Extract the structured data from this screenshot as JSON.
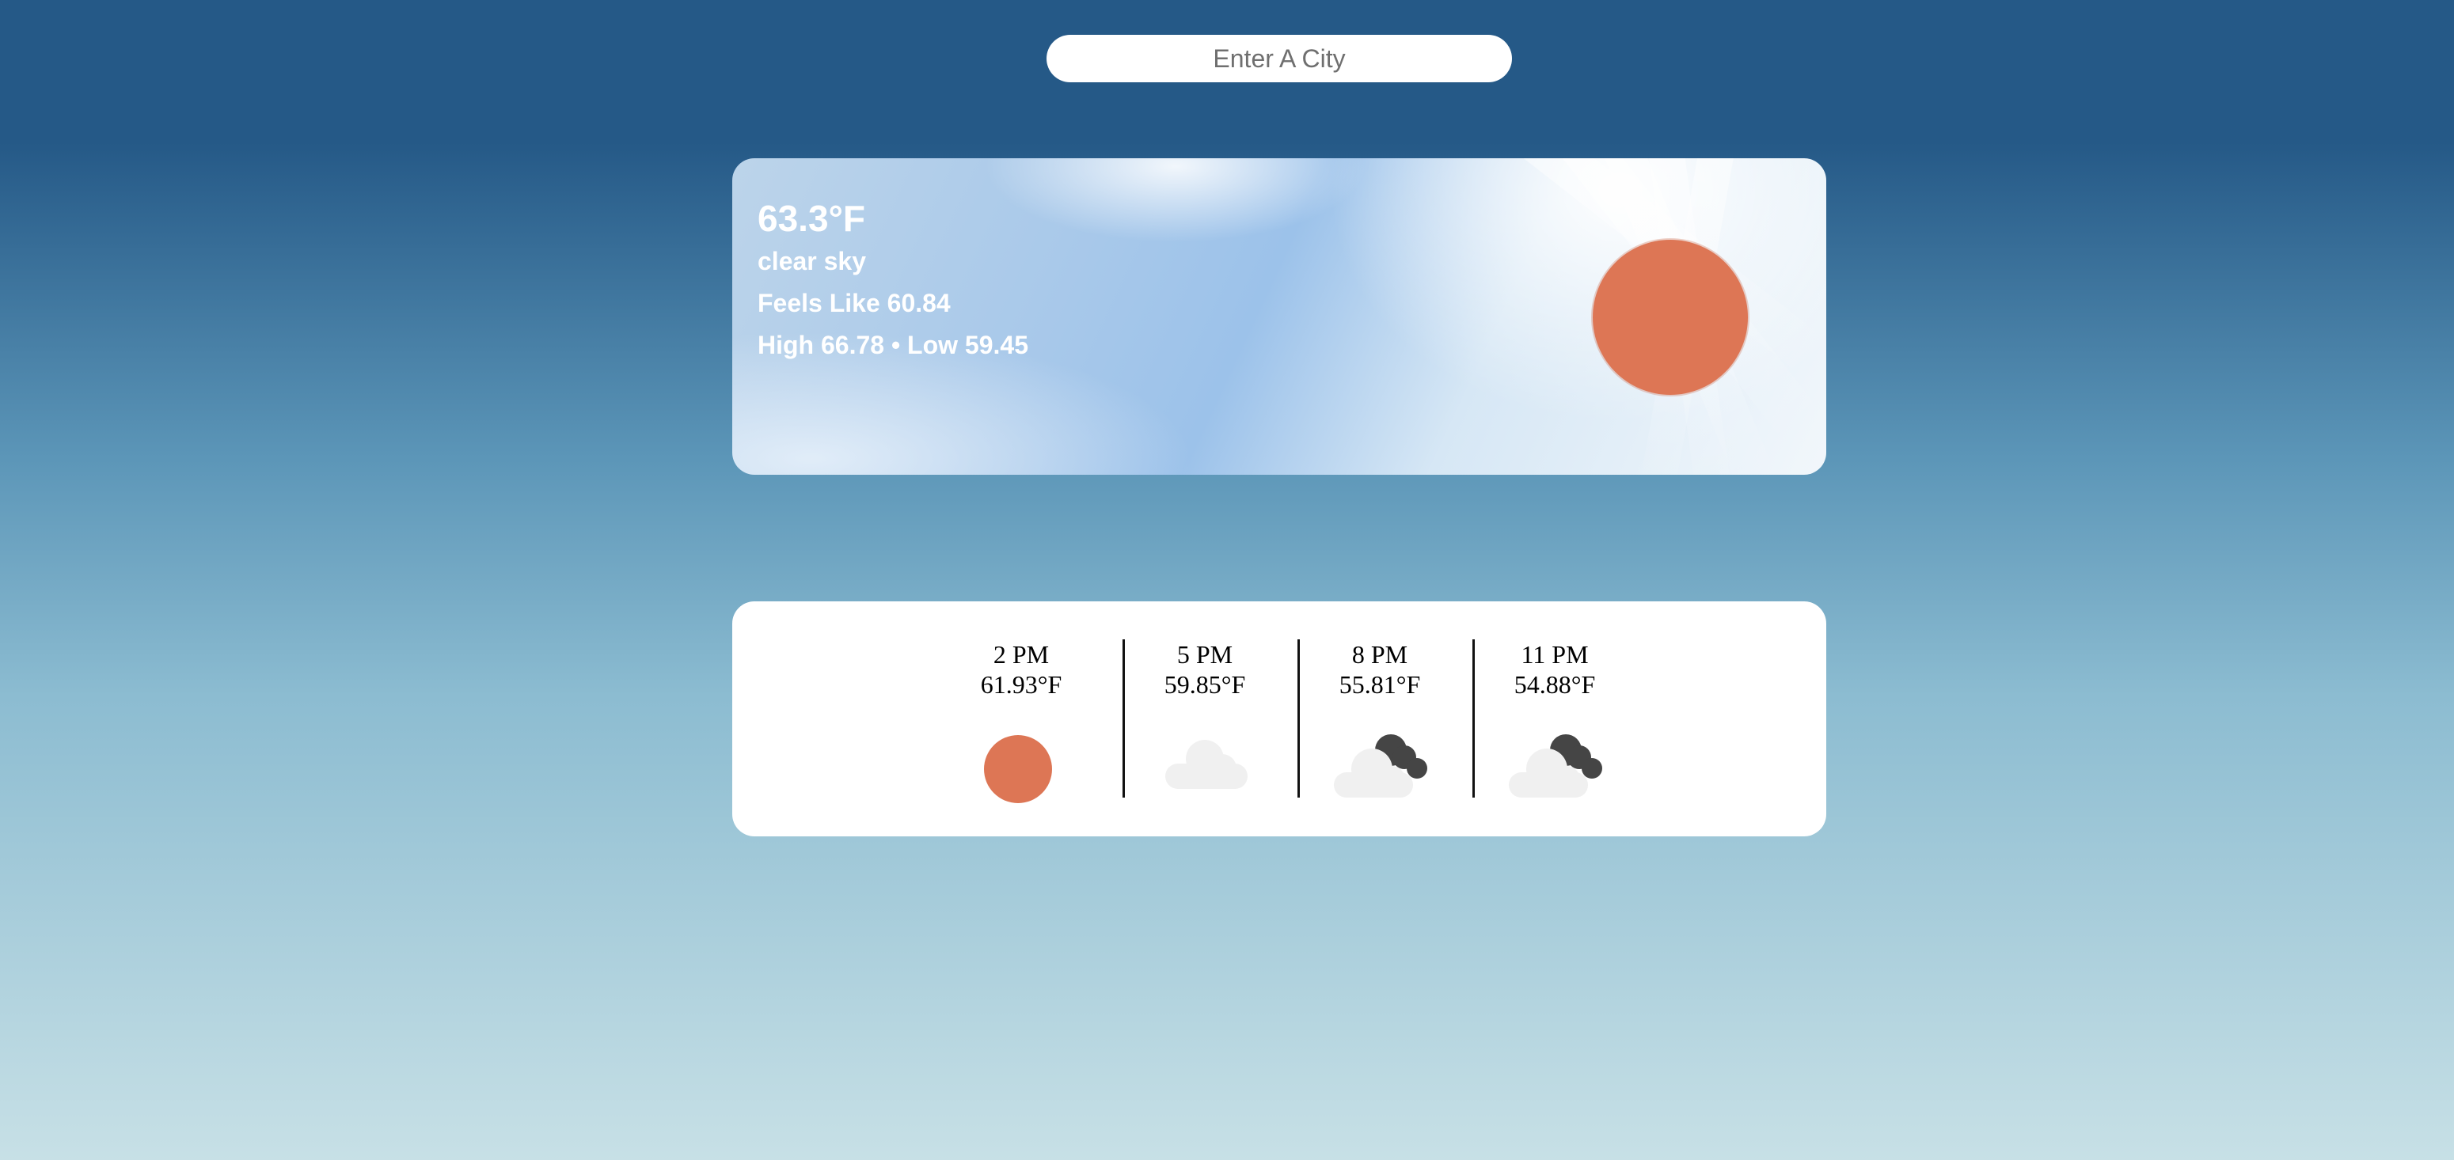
{
  "search": {
    "placeholder": "Enter A City",
    "value": ""
  },
  "current": {
    "temperature": "63.3°F",
    "description": "clear sky",
    "feels_like": "Feels Like 60.84",
    "high_low": "High 66.78 • Low 59.45",
    "icon": "sun-icon",
    "sun_color": "#dd7655"
  },
  "forecast": [
    {
      "time": "2 PM",
      "temp": "61.93°F",
      "icon": "sun-icon"
    },
    {
      "time": "5 PM",
      "temp": "59.85°F",
      "icon": "cloud-icon"
    },
    {
      "time": "8 PM",
      "temp": "55.81°F",
      "icon": "partly-cloudy-night-icon"
    },
    {
      "time": "11 PM",
      "temp": "54.88°F",
      "icon": "partly-cloudy-night-icon"
    }
  ],
  "colors": {
    "background_top": "#255987",
    "background_bottom": "#c7e0e6",
    "card": "#ffffff",
    "cloud": "#f0f0f0",
    "dark_cloud": "#454545"
  }
}
